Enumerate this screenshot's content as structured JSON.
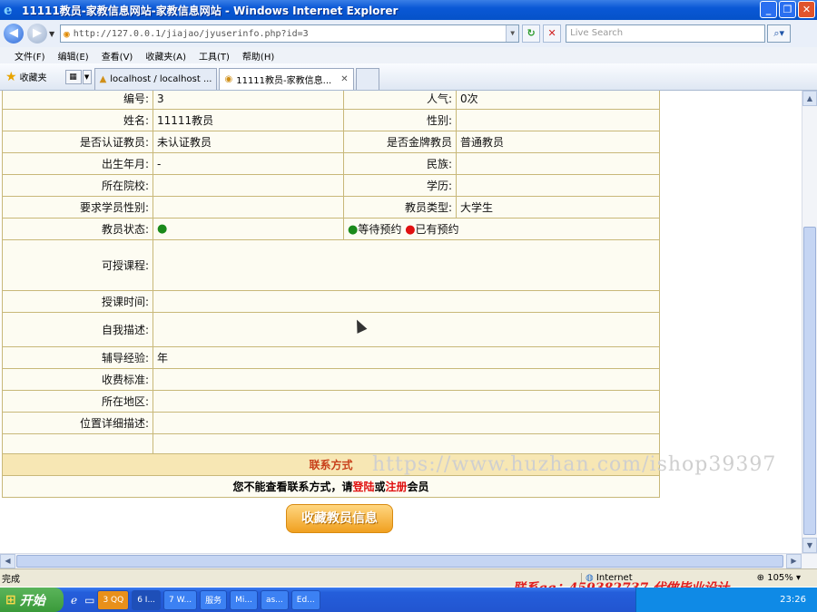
{
  "window": {
    "title": "11111教员-家教信息网站-家教信息网站 - Windows Internet Explorer"
  },
  "address": {
    "url": "http://127.0.0.1/jiajao/jyuserinfo.php?id=3",
    "search_placeholder": "Live Search"
  },
  "menu": [
    "文件(F)",
    "编辑(E)",
    "查看(V)",
    "收藏夹(A)",
    "工具(T)",
    "帮助(H)"
  ],
  "favorites": {
    "label": "收藏夹"
  },
  "tabs": [
    {
      "label": "localhost / localhost ..."
    },
    {
      "label": "11111教员-家教信息..."
    }
  ],
  "profile": {
    "rows": [
      {
        "l1": "编号:",
        "v1": "3",
        "l2": "人气:",
        "v2": "0次"
      },
      {
        "l1": "姓名:",
        "v1": "11111教员",
        "l2": "性别:",
        "v2": ""
      },
      {
        "l1": "是否认证教员:",
        "v1": "未认证教员",
        "l2": "是否金牌教员",
        "v2": "普通教员"
      },
      {
        "l1": "出生年月:",
        "v1": "-",
        "l2": "民族:",
        "v2": ""
      },
      {
        "l1": "所在院校:",
        "v1": "",
        "l2": "学历:",
        "v2": ""
      },
      {
        "l1": "要求学员性别:",
        "v1": "",
        "l2": "教员类型:",
        "v2": "大学生"
      }
    ],
    "status_label": "教员状态:",
    "status_waiting": "等待预约",
    "status_booked": "已有预约",
    "full_rows": [
      {
        "label": "可授课程:",
        "value": ""
      },
      {
        "label": "授课时间:",
        "value": ""
      },
      {
        "label": "自我描述:",
        "value": ""
      },
      {
        "label": "辅导经验:",
        "value": "年"
      },
      {
        "label": "收费标准:",
        "value": ""
      },
      {
        "label": "所在地区:",
        "value": ""
      },
      {
        "label": "位置详细描述:",
        "value": ""
      }
    ]
  },
  "contact": {
    "header": "联系方式",
    "msg_prefix": "您不能查看联系方式，请",
    "login": "登陆",
    "or": "或",
    "register": "注册",
    "msg_suffix": "会员"
  },
  "favorite_button": "收藏教员信息",
  "watermark": "https://www.huzhan.com/ishop39397",
  "status": {
    "text": "完成",
    "zone": "Internet",
    "zoom": "105%"
  },
  "qq_watermark": "联系qq：459382737 代做毕业设计",
  "taskbar": {
    "start": "开始",
    "tasks": [
      "3 QQ",
      "6 I...",
      "7 W...",
      "服务",
      "Mi...",
      "as...",
      "Ed..."
    ],
    "clock": "23:26"
  }
}
